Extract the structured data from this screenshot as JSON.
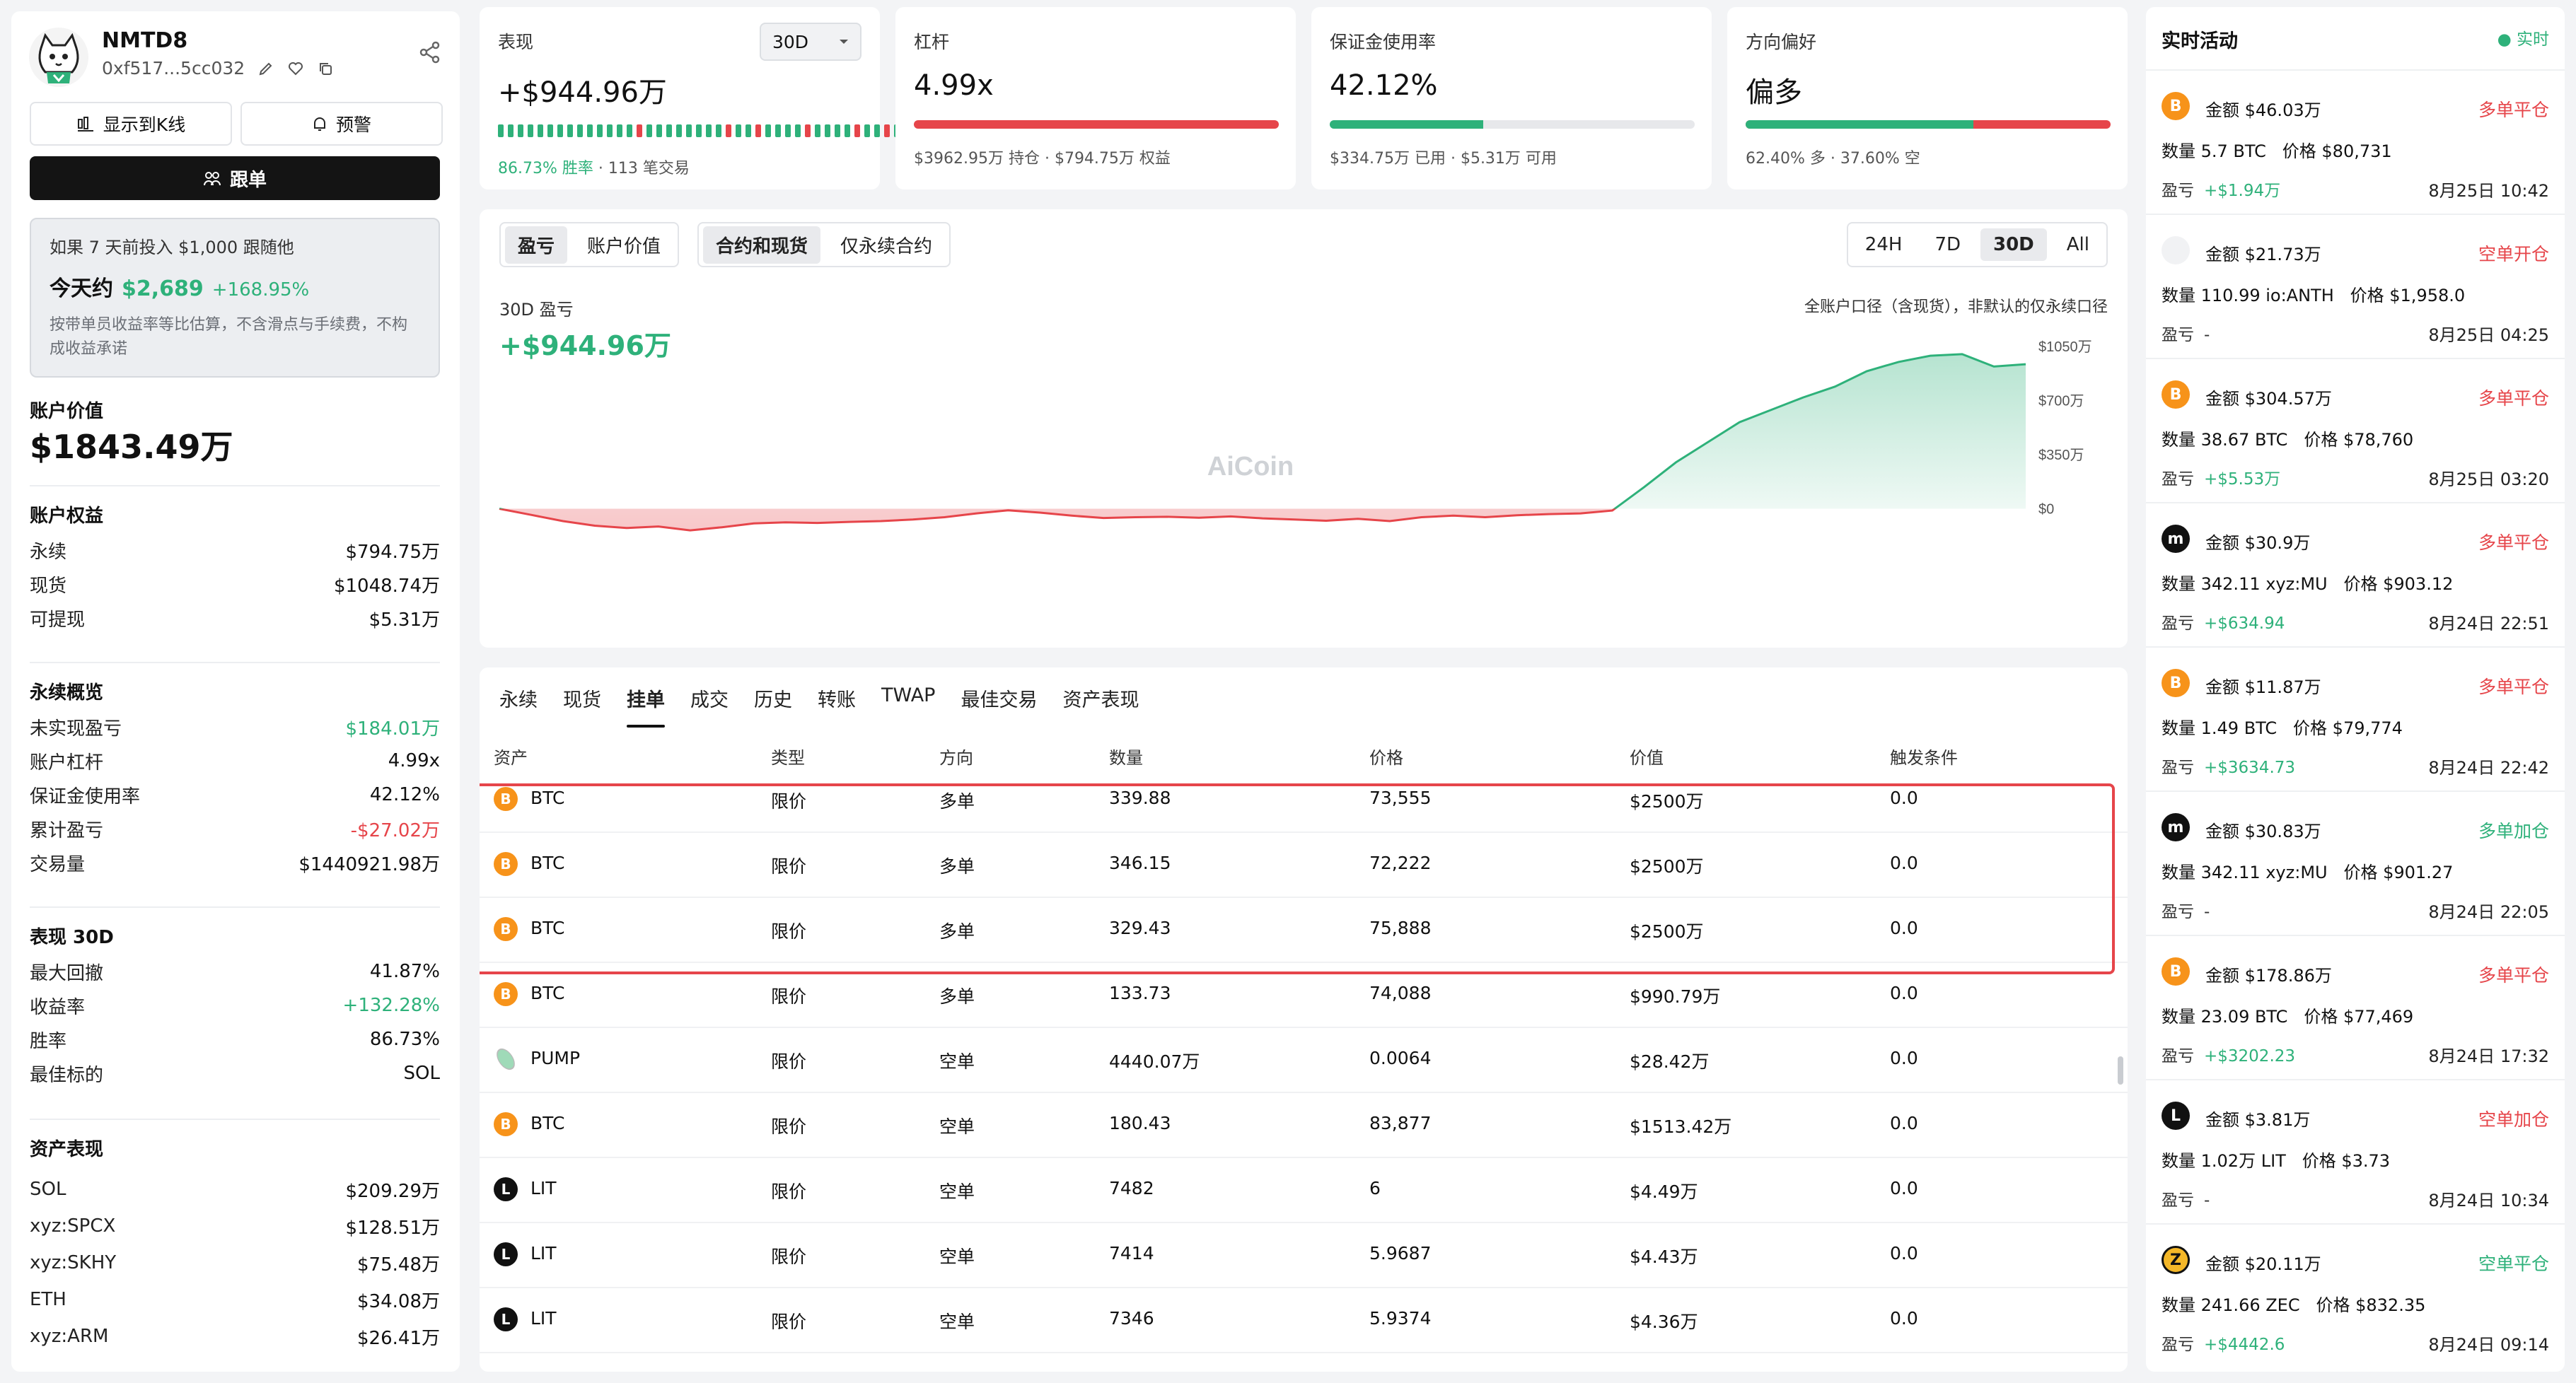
{
  "profile": {
    "name": "NMTD8",
    "address": "0xf517...5cc032",
    "btn_kline": "显示到K线",
    "btn_alert": "预警",
    "btn_follow": "跟单",
    "sim_title": "如果 7 天前投入 $1,000 跟随他",
    "sim_prefix": "今天约",
    "sim_value": "$2,689",
    "sim_pct": "+168.95%",
    "sim_note": "按带单员收益率等比估算，不含滑点与手续费，不构成收益承诺"
  },
  "account": {
    "value_label": "账户价值",
    "value": "$1843.49万",
    "equity_title": "账户权益",
    "equity": [
      {
        "k": "永续",
        "v": "$794.75万"
      },
      {
        "k": "现货",
        "v": "$1048.74万"
      },
      {
        "k": "可提现",
        "v": "$5.31万"
      }
    ],
    "perp_title": "永续概览",
    "perp": [
      {
        "k": "未实现盈亏",
        "v": "$184.01万"
      },
      {
        "k": "账户杠杆",
        "v": "4.99x"
      },
      {
        "k": "保证金使用率",
        "v": "42.12%"
      },
      {
        "k": "累计盈亏",
        "v": "-$27.02万"
      },
      {
        "k": "交易量",
        "v": "$1440921.98万"
      }
    ],
    "perf_title": "表现 30D",
    "perf": [
      {
        "k": "最大回撤",
        "v": "41.87%"
      },
      {
        "k": "收益率",
        "v": "+132.28%"
      },
      {
        "k": "胜率",
        "v": "86.73%"
      },
      {
        "k": "最佳标的",
        "v": "SOL"
      }
    ],
    "assets_title": "资产表现",
    "assets": [
      {
        "k": "SOL",
        "v": "$209.29万"
      },
      {
        "k": "xyz:SPCX",
        "v": "$128.51万"
      },
      {
        "k": "xyz:SKHY",
        "v": "$75.48万"
      },
      {
        "k": "ETH",
        "v": "$34.08万"
      },
      {
        "k": "xyz:ARM",
        "v": "$26.41万"
      }
    ]
  },
  "stats": {
    "perf": {
      "title": "表现",
      "period": "30D",
      "value": "+$944.96万",
      "win_rate": "86.73% 胜率",
      "trades": "· 113 笔交易"
    },
    "leverage": {
      "title": "杠杆",
      "value": "4.99x",
      "sub": "$3962.95万 持仓 · $794.75万 权益",
      "fill": 0.1
    },
    "margin": {
      "title": "保证金使用率",
      "value": "42.12%",
      "sub": "$334.75万 已用 · $5.31万 可用",
      "fill": 0.4212
    },
    "bias": {
      "title": "方向偏好",
      "value": "偏多",
      "sub": "62.40% 多 · 37.60% 空",
      "fill": 0.624
    }
  },
  "chart_tabs": {
    "metric": [
      "盈亏",
      "账户价值"
    ],
    "scope": [
      "合约和现货",
      "仅永续合约"
    ],
    "range": [
      "24H",
      "7D",
      "30D",
      "All"
    ]
  },
  "chart_data": {
    "type": "area",
    "subtitle": "30D 盈亏",
    "value": "+$944.96万",
    "note": "全账户口径（含现货），非默认的仅永续口径",
    "watermark": "AiCoin",
    "y_ticks": [
      "$1050万",
      "$700万",
      "$350万",
      "$0"
    ],
    "ylim": [
      -350,
      1050
    ],
    "values": [
      0,
      -40,
      -80,
      -110,
      -125,
      -115,
      -140,
      -120,
      -95,
      -88,
      -92,
      -85,
      -80,
      -70,
      -55,
      -30,
      -10,
      -25,
      -45,
      -60,
      -55,
      -52,
      -58,
      -50,
      -62,
      -70,
      -78,
      -65,
      -80,
      -55,
      -45,
      -55,
      -42,
      -35,
      -30,
      -12,
      140,
      300,
      430,
      560,
      640,
      720,
      790,
      890,
      950,
      990,
      1000,
      920,
      935
    ],
    "colors": {
      "up": "#2eb17a",
      "down": "#e6454a"
    }
  },
  "orders": {
    "tabs": [
      "永续",
      "现货",
      "挂单",
      "成交",
      "历史",
      "转账",
      "TWAP",
      "最佳交易",
      "资产表现"
    ],
    "columns": [
      "资产",
      "类型",
      "方向",
      "数量",
      "价格",
      "价值",
      "触发条件"
    ],
    "rows": [
      {
        "asset": "BTC",
        "icon": "btc",
        "type": "限价",
        "side": "多单",
        "qty": "339.88",
        "price": "73,555",
        "value": "$2500万",
        "trigger": "0.0"
      },
      {
        "asset": "BTC",
        "icon": "btc",
        "type": "限价",
        "side": "多单",
        "qty": "346.15",
        "price": "72,222",
        "value": "$2500万",
        "trigger": "0.0"
      },
      {
        "asset": "BTC",
        "icon": "btc",
        "type": "限价",
        "side": "多单",
        "qty": "329.43",
        "price": "75,888",
        "value": "$2500万",
        "trigger": "0.0"
      },
      {
        "asset": "BTC",
        "icon": "btc",
        "type": "限价",
        "side": "多单",
        "qty": "133.73",
        "price": "74,088",
        "value": "$990.79万",
        "trigger": "0.0"
      },
      {
        "asset": "PUMP",
        "icon": "pump",
        "type": "限价",
        "side": "空单",
        "qty": "4440.07万",
        "price": "0.0064",
        "value": "$28.42万",
        "trigger": "0.0"
      },
      {
        "asset": "BTC",
        "icon": "btc",
        "type": "限价",
        "side": "空单",
        "qty": "180.43",
        "price": "83,877",
        "value": "$1513.42万",
        "trigger": "0.0"
      },
      {
        "asset": "LIT",
        "icon": "lit",
        "type": "限价",
        "side": "空单",
        "qty": "7482",
        "price": "6",
        "value": "$4.49万",
        "trigger": "0.0"
      },
      {
        "asset": "LIT",
        "icon": "lit",
        "type": "限价",
        "side": "空单",
        "qty": "7414",
        "price": "5.9687",
        "value": "$4.43万",
        "trigger": "0.0"
      },
      {
        "asset": "LIT",
        "icon": "lit",
        "type": "限价",
        "side": "空单",
        "qty": "7346",
        "price": "5.9374",
        "value": "$4.36万",
        "trigger": "0.0"
      }
    ]
  },
  "live": {
    "title": "实时活动",
    "tag": "实时",
    "items": [
      {
        "icon": "btc",
        "amount": "金额 $46.03万",
        "side": "多单平仓",
        "side_color": "red",
        "detail": "数量 5.7 BTC   价格 $80,731",
        "pnl_label": "盈亏",
        "pnl": "+$1.94万",
        "pnl_color": "green",
        "time": "8月25日 10:42"
      },
      {
        "icon": "blank",
        "amount": "金额 $21.73万",
        "side": "空单开仓",
        "side_color": "red",
        "detail": "数量 110.99 io:ANTH   价格 $1,958.0",
        "pnl_label": "盈亏",
        "pnl": "-",
        "pnl_color": "gray",
        "time": "8月25日 04:25"
      },
      {
        "icon": "btc",
        "amount": "金额 $304.57万",
        "side": "多单平仓",
        "side_color": "red",
        "detail": "数量 38.67 BTC   价格 $78,760",
        "pnl_label": "盈亏",
        "pnl": "+$5.53万",
        "pnl_color": "green",
        "time": "8月25日 03:20"
      },
      {
        "icon": "mu",
        "amount": "金额 $30.9万",
        "side": "多单平仓",
        "side_color": "red",
        "detail": "数量 342.11 xyz:MU   价格 $903.12",
        "pnl_label": "盈亏",
        "pnl": "+$634.94",
        "pnl_color": "green",
        "time": "8月24日 22:51"
      },
      {
        "icon": "btc",
        "amount": "金额 $11.87万",
        "side": "多单平仓",
        "side_color": "red",
        "detail": "数量 1.49 BTC   价格 $79,774",
        "pnl_label": "盈亏",
        "pnl": "+$3634.73",
        "pnl_color": "green",
        "time": "8月24日 22:42"
      },
      {
        "icon": "mu",
        "amount": "金额 $30.83万",
        "side": "多单加仓",
        "side_color": "green",
        "detail": "数量 342.11 xyz:MU   价格 $901.27",
        "pnl_label": "盈亏",
        "pnl": "-",
        "pnl_color": "gray",
        "time": "8月24日 22:05"
      },
      {
        "icon": "btc",
        "amount": "金额 $178.86万",
        "side": "多单平仓",
        "side_color": "red",
        "detail": "数量 23.09 BTC   价格 $77,469",
        "pnl_label": "盈亏",
        "pnl": "+$3202.23",
        "pnl_color": "green",
        "time": "8月24日 17:32"
      },
      {
        "icon": "lit",
        "amount": "金额 $3.81万",
        "side": "空单加仓",
        "side_color": "red",
        "detail": "数量 1.02万 LIT   价格 $3.73",
        "pnl_label": "盈亏",
        "pnl": "-",
        "pnl_color": "gray",
        "time": "8月24日 10:34"
      },
      {
        "icon": "zec",
        "amount": "金额 $20.11万",
        "side": "空单平仓",
        "side_color": "green",
        "detail": "数量 241.66 ZEC   价格 $832.35",
        "pnl_label": "盈亏",
        "pnl": "+$4442.6",
        "pnl_color": "green",
        "time": "8月24日 09:14"
      }
    ]
  }
}
